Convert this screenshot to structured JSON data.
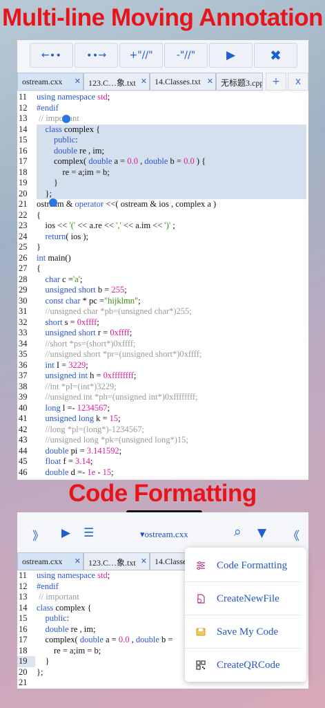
{
  "headline_top": "Multi-line Moving  Annotation",
  "headline_bottom": "Code Formatting",
  "toolbar": {
    "left_arrow": "←∙∙",
    "right_arrow": "∙∙→",
    "add_comment": "+\"//\"",
    "remove_comment": "-\"//\"",
    "run": "▶",
    "close": "✖"
  },
  "tabs": [
    {
      "label": "ostream.cxx",
      "close": "✕"
    },
    {
      "label": "123.C…象.txt",
      "close": "✕"
    },
    {
      "label": "14.Classes.txt",
      "close": "✕"
    },
    {
      "label": "无标题3.cpp",
      "close": ""
    }
  ],
  "tab_add": "+",
  "tab_close": "x",
  "code_lines": [
    {
      "n": "11",
      "html": "<span class='kw'>using namespace</span> <span class='num'>std</span>;"
    },
    {
      "n": "12",
      "html": "<span class='pp'>#endif</span>"
    },
    {
      "n": "13",
      "html": " <span class='cm'>// important</span>"
    },
    {
      "n": "14",
      "html": "    <span class='kw'>class</span> complex {"
    },
    {
      "n": "15",
      "html": "        <span class='kw'>public</span>:"
    },
    {
      "n": "16",
      "html": "        <span class='kw'>double</span> re , im;"
    },
    {
      "n": "17",
      "html": "        complex( <span class='kw'>double</span> a = <span class='num'>0.0</span> , <span class='kw'>double</span> b = <span class='num'>0.0</span> ) {"
    },
    {
      "n": "18",
      "html": "            re = a;im = b;"
    },
    {
      "n": "19",
      "html": "        }"
    },
    {
      "n": "20",
      "html": "    };"
    },
    {
      "n": "21",
      "html": "ostream &amp; <span class='kw'>operator</span> &lt;&lt;( ostream &amp; ios , complex a )"
    },
    {
      "n": "22",
      "html": "{"
    },
    {
      "n": "23",
      "html": "    ios &lt;&lt; <span class='str'>'('</span> &lt;&lt; a.re &lt;&lt; <span class='str'>','</span> &lt;&lt; a.im &lt;&lt; <span class='str'>')'</span> ;"
    },
    {
      "n": "24",
      "html": "    <span class='kw'>return</span>( ios );"
    },
    {
      "n": "25",
      "html": "}"
    },
    {
      "n": "26",
      "html": "<span class='kw'>int</span> main()"
    },
    {
      "n": "27",
      "html": "{"
    },
    {
      "n": "28",
      "html": "    <span class='kw'>char</span> c =<span class='str'>'a'</span>;"
    },
    {
      "n": "29",
      "html": "    <span class='kw'>unsigned short</span> b = <span class='num'>255</span>;"
    },
    {
      "n": "30",
      "html": "    <span class='kw'>const char</span> * pc =<span class='str'>\"hijklmn\"</span>;"
    },
    {
      "n": "31",
      "html": "    <span class='cm'>//unsigned char *pb=(unsigned char*)255;</span>"
    },
    {
      "n": "32",
      "html": "    <span class='kw'>short</span> s = <span class='num'>0xffff</span>;"
    },
    {
      "n": "33",
      "html": "    <span class='kw'>unsigned short</span> r = <span class='num'>0xffff</span>;"
    },
    {
      "n": "34",
      "html": "    <span class='cm'>//short *ps=(short*)0xffff;</span>"
    },
    {
      "n": "35",
      "html": "    <span class='cm'>//unsigned short *pr=(unsigned short*)0xffff;</span>"
    },
    {
      "n": "36",
      "html": "    <span class='kw'>int</span> I = <span class='num'>3229</span>;"
    },
    {
      "n": "37",
      "html": "    <span class='kw'>unsigned int</span> h = <span class='num'>0xffffffff</span>;"
    },
    {
      "n": "38",
      "html": "    <span class='cm'>//int *pI=(int*)3229;</span>"
    },
    {
      "n": "39",
      "html": "    <span class='cm'>//unsigned int *ph=(unsigned int*)0xffffffff;</span>"
    },
    {
      "n": "40",
      "html": "    <span class='kw'>long</span> l =- <span class='num'>1234567</span>;"
    },
    {
      "n": "41",
      "html": "    <span class='kw'>unsigned long</span> k = <span class='num'>15</span>;"
    },
    {
      "n": "42",
      "html": "    <span class='cm'>//long *pl=(long*)-1234567;</span>"
    },
    {
      "n": "43",
      "html": "    <span class='cm'>//unsigned long *pk=(unsigned long*)15;</span>"
    },
    {
      "n": "44",
      "html": "    <span class='kw'>double</span> pi = <span class='num'>3.141592</span>;"
    },
    {
      "n": "45",
      "html": "    <span class='kw'>float</span> f = <span class='num'>3.14</span>;"
    },
    {
      "n": "46",
      "html": "    <span class='kw'>double</span> d =- <span class='num'>1e</span> - <span class='num'>15</span>;"
    }
  ],
  "selected_range": [
    "14",
    "20"
  ],
  "toolbar2": {
    "expand": "》",
    "run": "▶",
    "outline": "☰",
    "file_label": "▾ostream.cxx",
    "search": "⌕",
    "down": "▼",
    "collapse": "《"
  },
  "tabs2": [
    {
      "label": "ostream.cxx",
      "close": "✕"
    },
    {
      "label": "123.C…象.txt",
      "close": "✕"
    },
    {
      "label": "14.Classe",
      "close": ""
    }
  ],
  "code_lines2": [
    {
      "n": "11",
      "html": "<span class='kw'>using namespace</span> <span class='num'>std</span>;"
    },
    {
      "n": "12",
      "html": "<span class='pp'>#endif</span>"
    },
    {
      "n": "13",
      "html": " <span class='cm'>// important</span>"
    },
    {
      "n": "14",
      "html": "<span class='kw'>class</span> complex {"
    },
    {
      "n": "15",
      "html": "    <span class='kw'>public</span>:"
    },
    {
      "n": "16",
      "html": "    <span class='kw'>double</span> re , im;"
    },
    {
      "n": "17",
      "html": "    complex( <span class='kw'>double</span> a = <span class='num'>0.0</span> , <span class='kw'>double</span> b ="
    },
    {
      "n": "18",
      "html": "        re = a;im = b;"
    },
    {
      "n": "19",
      "html": "    }"
    },
    {
      "n": "20",
      "html": "};"
    },
    {
      "n": "21",
      "html": ""
    }
  ],
  "current_line2": "19",
  "menu": [
    {
      "label": "Code Formatting",
      "icon": "sliders-icon"
    },
    {
      "label": "CreateNewFile",
      "icon": "new-file-icon"
    },
    {
      "label": "Save My Code",
      "icon": "save-icon"
    },
    {
      "label": "CreateQRCode",
      "icon": "qr-code-icon"
    }
  ],
  "colors": {
    "accent": "#1b5fd1",
    "headline": "#e8141b",
    "menu_text": "#2556c4",
    "selection": "#d4e0ee"
  }
}
